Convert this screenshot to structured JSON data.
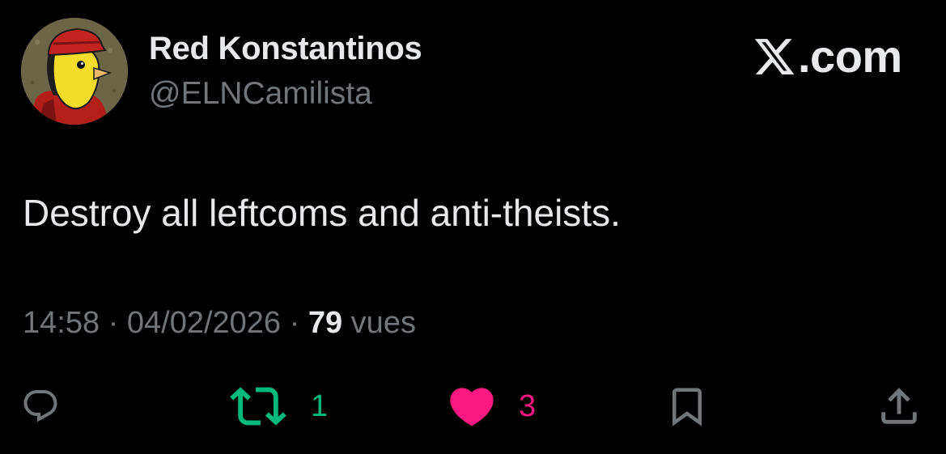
{
  "author": {
    "display_name": "Red Konstantinos",
    "handle": "@ELNCamilista",
    "avatar_icon": "canary-with-red-cap-avatar"
  },
  "brand": {
    "logo_icon": "x-logo-icon",
    "suffix": ".com"
  },
  "tweet": {
    "text": "Destroy all leftcoms and anti-theists."
  },
  "meta": {
    "time": "14:58",
    "separator": " · ",
    "date": "04/02/2026",
    "views_count": "79",
    "views_label": " vues"
  },
  "actions": {
    "reply": {
      "icon": "reply-icon"
    },
    "retweet": {
      "icon": "retweet-icon",
      "count": "1",
      "color": "#00ba7c"
    },
    "like": {
      "icon": "heart-icon",
      "count": "3",
      "color": "#f91880"
    },
    "bookmark": {
      "icon": "bookmark-icon"
    },
    "share": {
      "icon": "share-icon"
    }
  },
  "colors": {
    "background": "#000000",
    "primary_text": "#e7e9ea",
    "secondary_text": "#71767b"
  }
}
